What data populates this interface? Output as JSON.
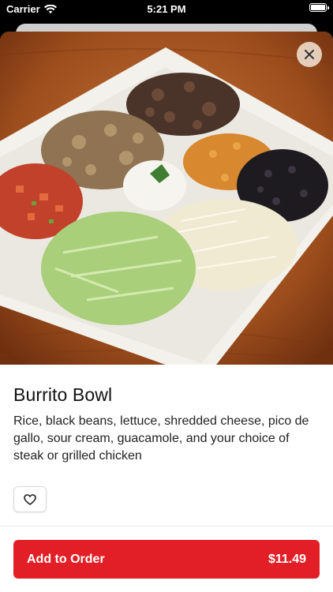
{
  "status_bar": {
    "carrier": "Carrier",
    "time": "5:21 PM",
    "wifi_icon": "wifi-icon",
    "battery_icon": "battery-icon"
  },
  "item": {
    "title": "Burrito Bowl",
    "description": "Rice, black beans, lettuce, shredded cheese, pico de gallo, sour cream, guacamole, and your choice of steak or grilled chicken",
    "image_subject": "Burrito bowl on a white plate"
  },
  "actions": {
    "close_icon": "close-icon",
    "favorite_icon": "heart-icon",
    "add_to_order_label": "Add to Order",
    "price": "$11.49"
  },
  "colors": {
    "accent": "#e21f26",
    "background": "#ffffff",
    "text": "#111111"
  }
}
